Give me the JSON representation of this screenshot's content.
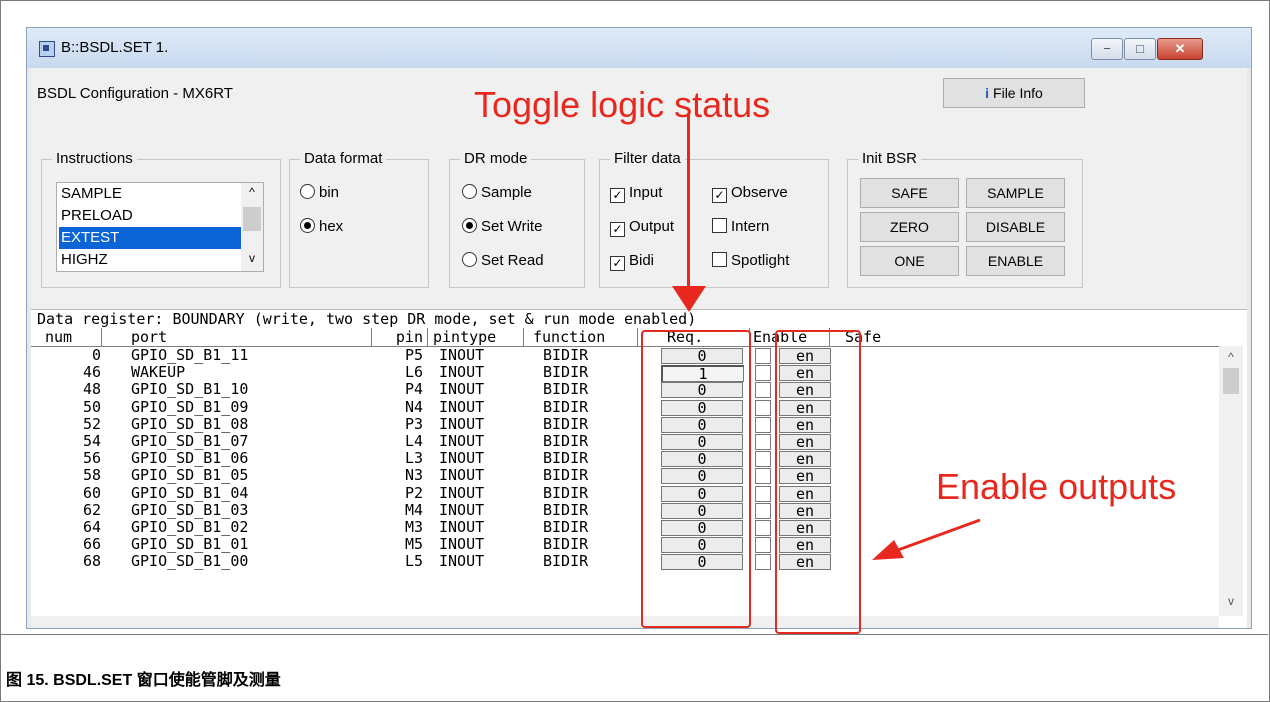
{
  "window": {
    "title": "B::BSDL.SET 1.",
    "min": "−",
    "max": "□",
    "close": "✕"
  },
  "config": {
    "title": "BSDL Configuration -  MX6RT",
    "file_info": "File Info",
    "file_info_icon": "info-icon"
  },
  "instructions": {
    "label": "Instructions",
    "items": [
      "SAMPLE",
      "PRELOAD",
      "EXTEST",
      "HIGHZ"
    ],
    "selected": "EXTEST"
  },
  "data_format": {
    "label": "Data format",
    "options": [
      "bin",
      "hex"
    ],
    "selected": "hex"
  },
  "dr_mode": {
    "label": "DR mode",
    "options": [
      "Sample",
      "Set Write",
      "Set Read"
    ],
    "selected": "Set Write"
  },
  "filter_data": {
    "label": "Filter data",
    "items": [
      {
        "label": "Input",
        "checked": true
      },
      {
        "label": "Observe",
        "checked": true
      },
      {
        "label": "Output",
        "checked": true
      },
      {
        "label": "Intern",
        "checked": false
      },
      {
        "label": "Bidi",
        "checked": true
      },
      {
        "label": "Spotlight",
        "checked": false
      }
    ]
  },
  "init_bsr": {
    "label": "Init BSR",
    "buttons": [
      "SAFE",
      "SAMPLE",
      "ZERO",
      "DISABLE",
      "ONE",
      "ENABLE"
    ]
  },
  "data_register": {
    "header": "Data register: BOUNDARY (write, two step DR mode, set & run mode enabled)",
    "columns": [
      "num",
      "port",
      "pin",
      "pintype",
      "function",
      "Req.",
      "Enable",
      "Safe"
    ],
    "rows": [
      {
        "num": "0",
        "port": "GPIO_SD_B1_11",
        "pin": "P5",
        "pintype": "INOUT",
        "function": "BIDIR",
        "req": "0",
        "enable": "en"
      },
      {
        "num": "46",
        "port": "WAKEUP",
        "pin": "L6",
        "pintype": "INOUT",
        "function": "BIDIR",
        "req": "1",
        "enable": "en"
      },
      {
        "num": "48",
        "port": "GPIO_SD_B1_10",
        "pin": "P4",
        "pintype": "INOUT",
        "function": "BIDIR",
        "req": "0",
        "enable": "en"
      },
      {
        "num": "50",
        "port": "GPIO_SD_B1_09",
        "pin": "N4",
        "pintype": "INOUT",
        "function": "BIDIR",
        "req": "0",
        "enable": "en"
      },
      {
        "num": "52",
        "port": "GPIO_SD_B1_08",
        "pin": "P3",
        "pintype": "INOUT",
        "function": "BIDIR",
        "req": "0",
        "enable": "en"
      },
      {
        "num": "54",
        "port": "GPIO_SD_B1_07",
        "pin": "L4",
        "pintype": "INOUT",
        "function": "BIDIR",
        "req": "0",
        "enable": "en"
      },
      {
        "num": "56",
        "port": "GPIO_SD_B1_06",
        "pin": "L3",
        "pintype": "INOUT",
        "function": "BIDIR",
        "req": "0",
        "enable": "en"
      },
      {
        "num": "58",
        "port": "GPIO_SD_B1_05",
        "pin": "N3",
        "pintype": "INOUT",
        "function": "BIDIR",
        "req": "0",
        "enable": "en"
      },
      {
        "num": "60",
        "port": "GPIO_SD_B1_04",
        "pin": "P2",
        "pintype": "INOUT",
        "function": "BIDIR",
        "req": "0",
        "enable": "en"
      },
      {
        "num": "62",
        "port": "GPIO_SD_B1_03",
        "pin": "M4",
        "pintype": "INOUT",
        "function": "BIDIR",
        "req": "0",
        "enable": "en"
      },
      {
        "num": "64",
        "port": "GPIO_SD_B1_02",
        "pin": "M3",
        "pintype": "INOUT",
        "function": "BIDIR",
        "req": "0",
        "enable": "en"
      },
      {
        "num": "66",
        "port": "GPIO_SD_B1_01",
        "pin": "M5",
        "pintype": "INOUT",
        "function": "BIDIR",
        "req": "0",
        "enable": "en"
      },
      {
        "num": "68",
        "port": "GPIO_SD_B1_00",
        "pin": "L5",
        "pintype": "INOUT",
        "function": "BIDIR",
        "req": "0",
        "enable": "en"
      }
    ]
  },
  "annotations": {
    "toggle": "Toggle logic status",
    "enable": "Enable outputs",
    "color": "#e8281e"
  },
  "caption": "图 15. BSDL.SET 窗口使能管脚及测量"
}
